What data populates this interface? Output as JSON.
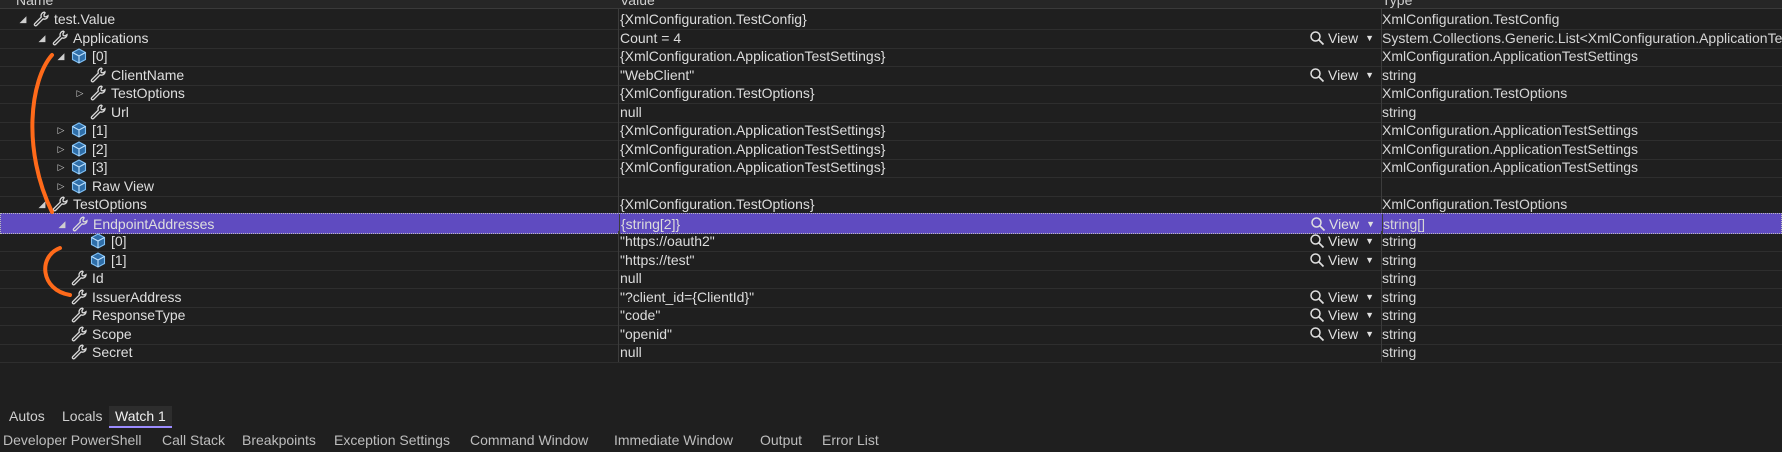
{
  "header": {
    "col_name": "Name",
    "col_value": "Value",
    "col_type": "Type"
  },
  "rows": [
    {
      "indent": 0,
      "arrow": "down",
      "icon": "wrench-icon",
      "name": "test.Value",
      "value": "{XmlConfiguration.TestConfig}",
      "type": "XmlConfiguration.TestConfig",
      "view": false
    },
    {
      "indent": 1,
      "arrow": "down",
      "icon": "wrench-icon",
      "name": "Applications",
      "value": "Count = 4",
      "type": "System.Collections.Generic.List<XmlConfiguration.ApplicationTestSettings>",
      "view": true
    },
    {
      "indent": 2,
      "arrow": "down",
      "icon": "cube-icon",
      "name": "[0]",
      "value": "{XmlConfiguration.ApplicationTestSettings}",
      "type": "XmlConfiguration.ApplicationTestSettings",
      "view": false
    },
    {
      "indent": 3,
      "arrow": "none",
      "icon": "wrench-icon",
      "name": "ClientName",
      "value": "\"WebClient\"",
      "type": "string",
      "view": true
    },
    {
      "indent": 3,
      "arrow": "right",
      "icon": "wrench-icon",
      "name": "TestOptions",
      "value": "{XmlConfiguration.TestOptions}",
      "type": "XmlConfiguration.TestOptions",
      "view": false
    },
    {
      "indent": 3,
      "arrow": "none",
      "icon": "wrench-icon",
      "name": "Url",
      "value": "null",
      "type": "string",
      "view": false
    },
    {
      "indent": 2,
      "arrow": "right",
      "icon": "cube-icon",
      "name": "[1]",
      "value": "{XmlConfiguration.ApplicationTestSettings}",
      "type": "XmlConfiguration.ApplicationTestSettings",
      "view": false
    },
    {
      "indent": 2,
      "arrow": "right",
      "icon": "cube-icon",
      "name": "[2]",
      "value": "{XmlConfiguration.ApplicationTestSettings}",
      "type": "XmlConfiguration.ApplicationTestSettings",
      "view": false
    },
    {
      "indent": 2,
      "arrow": "right",
      "icon": "cube-icon",
      "name": "[3]",
      "value": "{XmlConfiguration.ApplicationTestSettings}",
      "type": "XmlConfiguration.ApplicationTestSettings",
      "view": false
    },
    {
      "indent": 2,
      "arrow": "right",
      "icon": "cube-icon",
      "name": "Raw View",
      "value": "",
      "type": "",
      "view": false
    },
    {
      "indent": 1,
      "arrow": "down",
      "icon": "wrench-icon",
      "name": "TestOptions",
      "value": "{XmlConfiguration.TestOptions}",
      "type": "XmlConfiguration.TestOptions",
      "view": false
    },
    {
      "indent": 2,
      "arrow": "down",
      "icon": "wrench-icon",
      "name": "EndpointAddresses",
      "value": "{string[2]}",
      "type": "string[]",
      "view": true,
      "selected": true
    },
    {
      "indent": 3,
      "arrow": "none",
      "icon": "cube-icon",
      "name": "[0]",
      "value": "\"https://oauth2\"",
      "type": "string",
      "view": true
    },
    {
      "indent": 3,
      "arrow": "none",
      "icon": "cube-icon",
      "name": "[1]",
      "value": "\"https://test\"",
      "type": "string",
      "view": true
    },
    {
      "indent": 2,
      "arrow": "none",
      "icon": "wrench-icon",
      "name": "Id",
      "value": "null",
      "type": "string",
      "view": false
    },
    {
      "indent": 2,
      "arrow": "none",
      "icon": "wrench-icon",
      "name": "IssuerAddress",
      "value": "\"?client_id={ClientId}\"",
      "type": "string",
      "view": true
    },
    {
      "indent": 2,
      "arrow": "none",
      "icon": "wrench-icon",
      "name": "ResponseType",
      "value": "\"code\"",
      "type": "string",
      "view": true
    },
    {
      "indent": 2,
      "arrow": "none",
      "icon": "wrench-icon",
      "name": "Scope",
      "value": "\"openid\"",
      "type": "string",
      "view": true
    },
    {
      "indent": 2,
      "arrow": "none",
      "icon": "wrench-icon",
      "name": "Secret",
      "value": "null",
      "type": "string",
      "view": false
    }
  ],
  "view_label": "View",
  "tool_tabs": [
    "Autos",
    "Locals",
    "Watch 1"
  ],
  "bottom_tabs": [
    "Developer PowerShell",
    "Call Stack",
    "Breakpoints",
    "Exception Settings",
    "Command Window",
    "Immediate Window",
    "Output",
    "Error List"
  ],
  "colors": {
    "selection": "#5f4bc0",
    "annotation": "#ff6a1a",
    "cube": "#4d9de0"
  }
}
